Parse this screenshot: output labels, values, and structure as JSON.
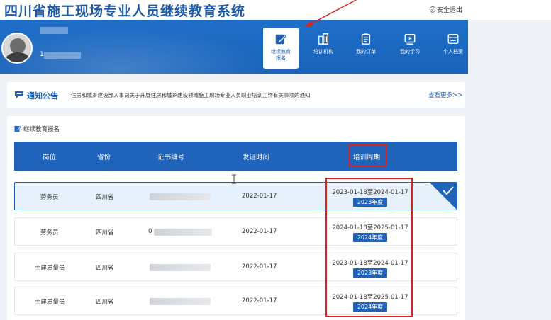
{
  "site": {
    "title": "四川省施工现场专业人员继续教育系统",
    "logout_label": "安全退出"
  },
  "user": {
    "id_prefix": "1"
  },
  "nav": [
    {
      "label_line1": "继续教育",
      "label_line2": "报名",
      "icon": "edit-icon",
      "active": true
    },
    {
      "label_line1": "培训机构",
      "label_line2": "",
      "icon": "building-icon",
      "active": false
    },
    {
      "label_line1": "我的订单",
      "label_line2": "",
      "icon": "clipboard-icon",
      "active": false
    },
    {
      "label_line1": "我的学习",
      "label_line2": "",
      "icon": "video-icon",
      "active": false
    },
    {
      "label_line1": "个人档案",
      "label_line2": "",
      "icon": "profile-card-icon",
      "active": false
    }
  ],
  "notice": {
    "title": "通知公告",
    "text": "住房和城乡建设部人事司关于开展住房和城乡建设领域施工现场专业人员职业培训工作有关事项的通知",
    "more_label": "查看更多>>"
  },
  "panel": {
    "title": "继续教育报名"
  },
  "table": {
    "headers": [
      "岗位",
      "省份",
      "证书编号",
      "发证时间",
      "培训周期"
    ],
    "rows": [
      {
        "position": "劳务员",
        "province": "四川省",
        "cert_prefix": "",
        "issue_date": "2022-01-17",
        "period": "2023-01-18至2024-01-17",
        "year": "2023年度",
        "selected": true
      },
      {
        "position": "劳务员",
        "province": "四川省",
        "cert_prefix": "0",
        "issue_date": "2022-01-17",
        "period": "2024-01-18至2025-01-17",
        "year": "2024年度",
        "selected": false
      },
      {
        "position": "土建质量员",
        "province": "四川省",
        "cert_prefix": "",
        "issue_date": "2022-01-17",
        "period": "2023-01-18至2024-01-17",
        "year": "2023年度",
        "selected": false
      },
      {
        "position": "土建质量员",
        "province": "四川省",
        "cert_prefix": "",
        "issue_date": "2022-01-17",
        "period": "2024-01-18至2025-01-17",
        "year": "2024年度",
        "selected": false
      }
    ]
  },
  "colors": {
    "primary": "#1f63ba",
    "annotation": "#e02020"
  }
}
